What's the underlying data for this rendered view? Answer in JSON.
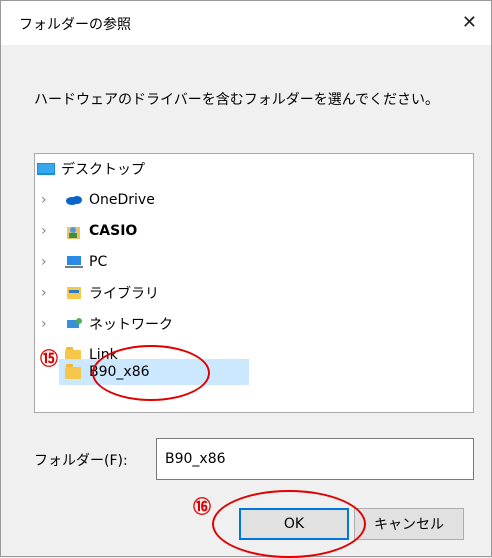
{
  "window": {
    "title": "フォルダーの参照",
    "close_glyph": "✕"
  },
  "instruction": "ハードウェアのドライバーを含むフォルダーを選んでください。",
  "tree": {
    "items": [
      {
        "label": "デスクトップ",
        "icon": "desktop-icon"
      },
      {
        "label": "OneDrive",
        "icon": "cloud-icon"
      },
      {
        "label": "CASIO",
        "icon": "user-icon"
      },
      {
        "label": "PC",
        "icon": "computer-icon"
      },
      {
        "label": "ライブラリ",
        "icon": "library-icon"
      },
      {
        "label": "ネットワーク",
        "icon": "network-icon"
      },
      {
        "label": "Link",
        "icon": "folder-shortcut-icon"
      },
      {
        "label": "B90_x86",
        "icon": "folder-icon",
        "selected": true
      }
    ]
  },
  "folder_field": {
    "label": "フォルダー(F):",
    "value": "B90_x86"
  },
  "buttons": {
    "ok": "OK",
    "cancel": "キャンセル"
  },
  "annotations": {
    "step15": "⑮",
    "step16": "⑯"
  },
  "colors": {
    "selection": "#cce8ff",
    "annotation": "#e00000",
    "ok_border": "#0078d7"
  }
}
